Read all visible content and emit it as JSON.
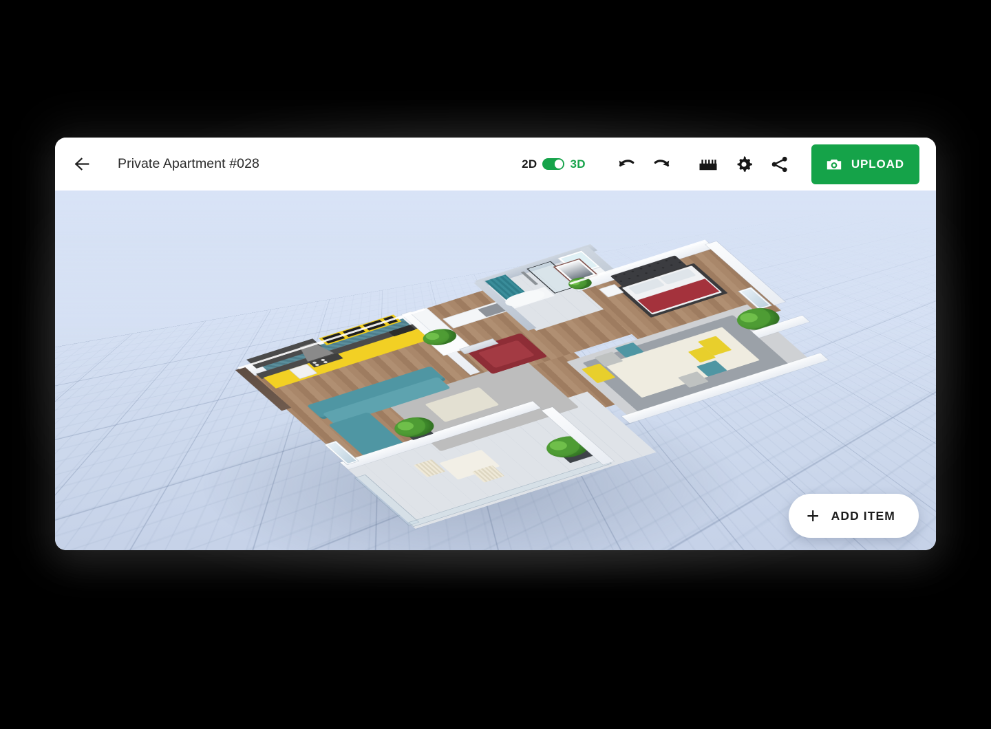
{
  "app": {
    "window_background": "#000000",
    "card_background": "#ffffff",
    "accent_green": "#15a349"
  },
  "header": {
    "back_icon": "arrow-left-icon",
    "title": "Private Apartment #028",
    "view_toggle": {
      "left_label": "2D",
      "right_label": "3D",
      "active": "3D",
      "track_color": "#16a34a",
      "knob_color": "#ffffff"
    },
    "tools": [
      {
        "name": "undo-icon",
        "label": "Undo"
      },
      {
        "name": "redo-icon",
        "label": "Redo"
      },
      {
        "name": "ruler-icon",
        "label": "Measure"
      },
      {
        "name": "gear-icon",
        "label": "Settings"
      },
      {
        "name": "share-icon",
        "label": "Share"
      }
    ],
    "upload_button": {
      "label": "UPLOAD",
      "icon": "camera-icon",
      "background": "#15a349",
      "text_color": "#ffffff"
    }
  },
  "viewport": {
    "mode": "3D",
    "background_top": "#d8e3f6",
    "background_bottom": "#c6d2e8",
    "grid": "perspective-floor-grid",
    "grid_line_color": "#6c80a2",
    "scene_name": "apartment-floorplan-3d",
    "rooms": [
      {
        "name": "kitchen",
        "items": [
          "yellow-upper-cabinets",
          "yellow-base-cabinets",
          "dark-countertop",
          "range-hood",
          "oven",
          "cooktop",
          "sink",
          "teal-tile-backsplash"
        ],
        "palette": {
          "cabinets": "#f2d024",
          "counter": "#4a4a4a",
          "backsplash": "#4d7e8c"
        }
      },
      {
        "name": "living-room",
        "items": [
          "teal-sectional-sofa",
          "red-armchair",
          "cream-coffee-table",
          "grey-area-rug",
          "potted-plant",
          "sliding-glass-door"
        ],
        "palette": {
          "sofa": "#4f96a3",
          "armchair": "#8e2d36",
          "table": "#e3e0d2",
          "rug": "#bdbdbd"
        }
      },
      {
        "name": "dining-room",
        "items": [
          "dining-table",
          "yellow-chair",
          "yellow-chair",
          "teal-chair",
          "teal-chair",
          "grey-chair",
          "grey-chair",
          "grey-shag-rug",
          "potted-plant"
        ],
        "palette": {
          "table": "#efece0",
          "chair_yellow": "#e8cf2c",
          "chair_teal": "#4f96a3",
          "chair_grey": "#bfc2c1"
        }
      },
      {
        "name": "bedroom",
        "items": [
          "king-bed",
          "tufted-dark-headboard",
          "red-bed-throw",
          "two-pillows",
          "nightstand",
          "framed-wall-art",
          "potted-plant"
        ],
        "palette": {
          "headboard": "#3b3c40",
          "throw": "#a4323c",
          "bedding": "#f1f2f4"
        }
      },
      {
        "name": "bathroom",
        "items": [
          "bathtub",
          "teal-shower-curtain",
          "glass-shower-enclosure",
          "rain-shower-head",
          "vanity",
          "lit-mirror",
          "side-table",
          "potted-plant"
        ],
        "palette": {
          "curtain": "#2e7d8a",
          "fixtures": "#f7f9fa"
        }
      },
      {
        "name": "hallway",
        "items": [
          "white-sideboard",
          "open-shelf-unit",
          "tall-wardrobe",
          "white-planter",
          "entry-door"
        ],
        "palette": {
          "cabinets": "#f4f6f8"
        }
      },
      {
        "name": "balcony",
        "items": [
          "bistro-table",
          "folding-chair",
          "folding-chair",
          "glass-railing",
          "potted-shrub",
          "tile-floor"
        ],
        "palette": {
          "furniture": "#f2efe6",
          "railing": "#c6dae6"
        }
      }
    ]
  },
  "add_item_button": {
    "label": "ADD ITEM",
    "icon": "plus-icon",
    "background": "#ffffff",
    "text_color": "#1c1c1c"
  }
}
